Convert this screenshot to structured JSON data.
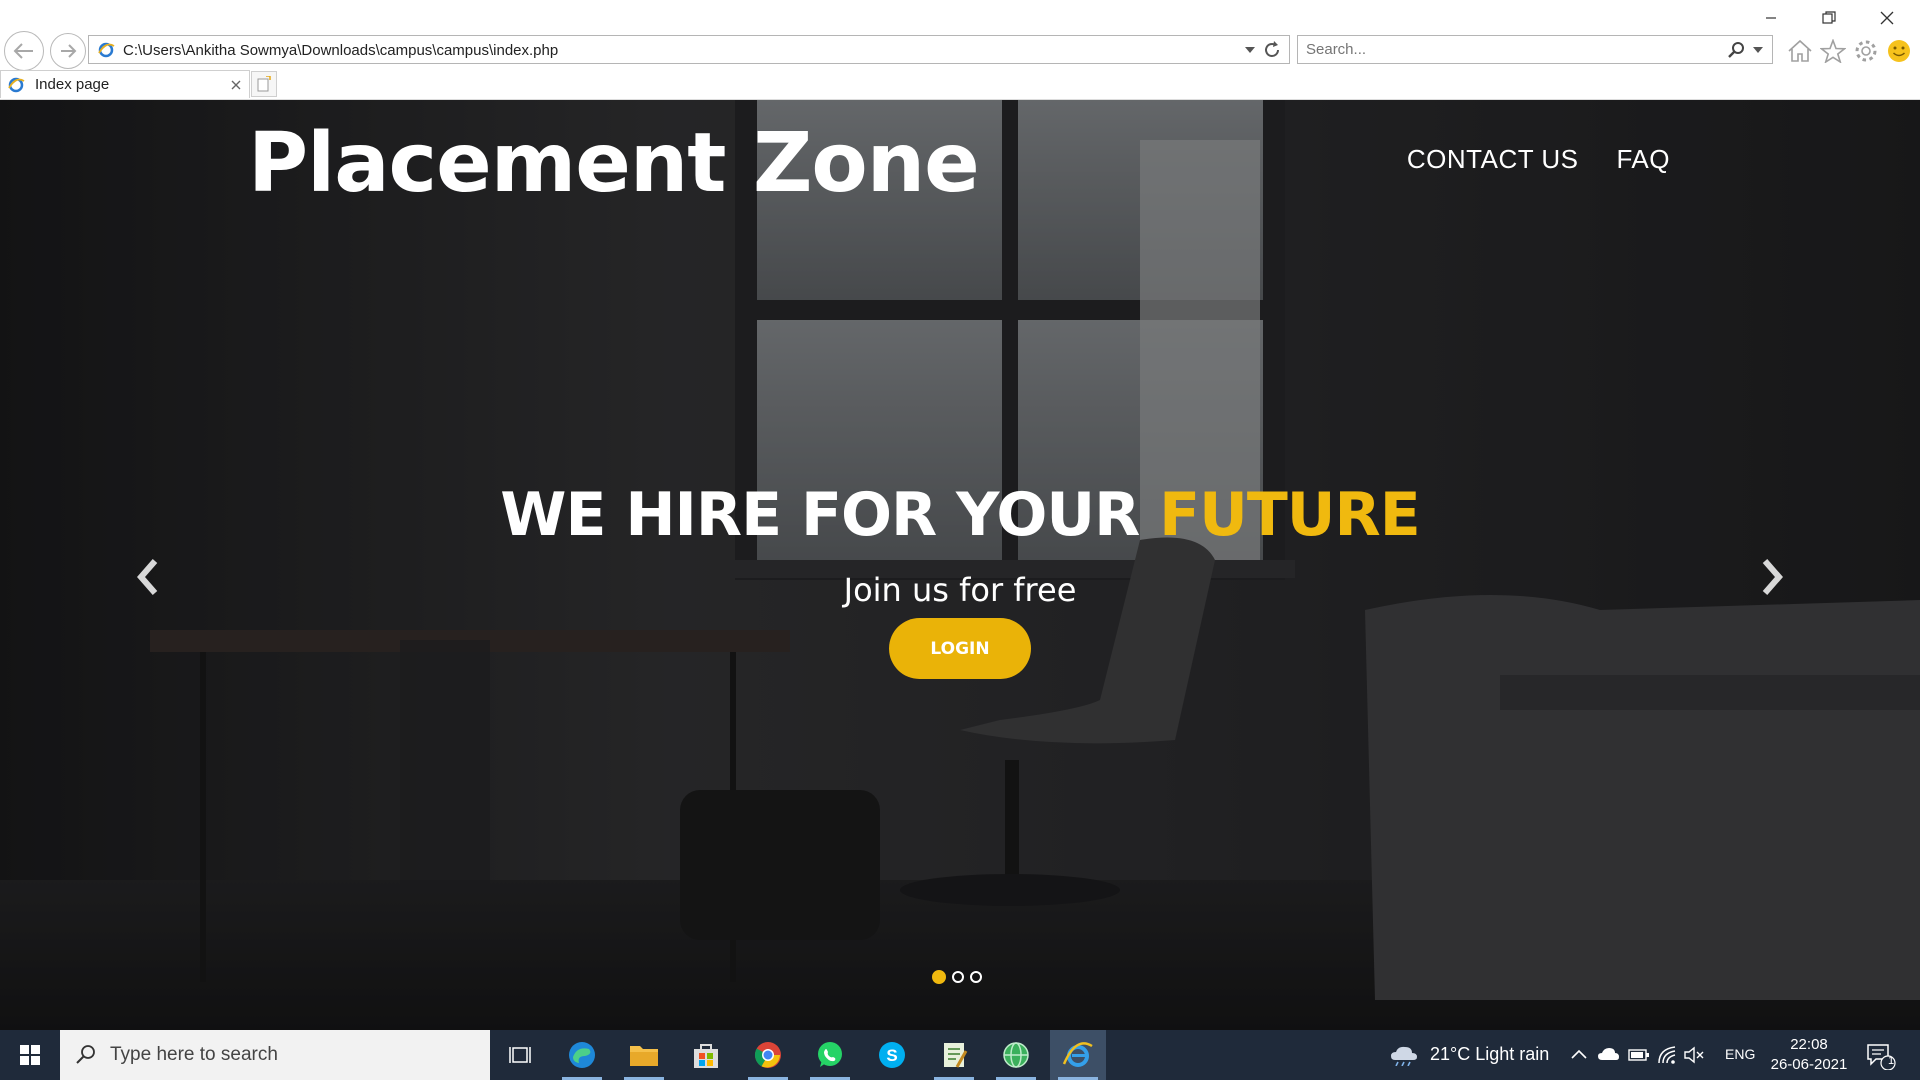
{
  "browser": {
    "address_url": "C:\\Users\\Ankitha Sowmya\\Downloads\\campus\\campus\\index.php",
    "search_placeholder": "Search...",
    "tab_title": "Index page"
  },
  "page": {
    "brand": "Placement Zone",
    "nav": [
      "CONTACT US",
      "FAQ"
    ],
    "headline_main": "WE HIRE FOR YOUR ",
    "headline_accent": "FUTURE",
    "subheadline": "Join us for free",
    "login_label": "LOGIN",
    "carousel": {
      "slides": 3,
      "active": 1
    },
    "colors": {
      "accent": "#f0b90f",
      "button": "#eab308"
    }
  },
  "taskbar": {
    "search_placeholder": "Type here to search",
    "weather": "21°C  Light rain",
    "language": "ENG",
    "time": "22:08",
    "date": "26-06-2021",
    "notification_count": "1",
    "apps": [
      "task-view",
      "edge",
      "file-explorer",
      "store",
      "chrome",
      "whatsapp",
      "skype",
      "notepad",
      "network-app",
      "internet-explorer"
    ]
  }
}
